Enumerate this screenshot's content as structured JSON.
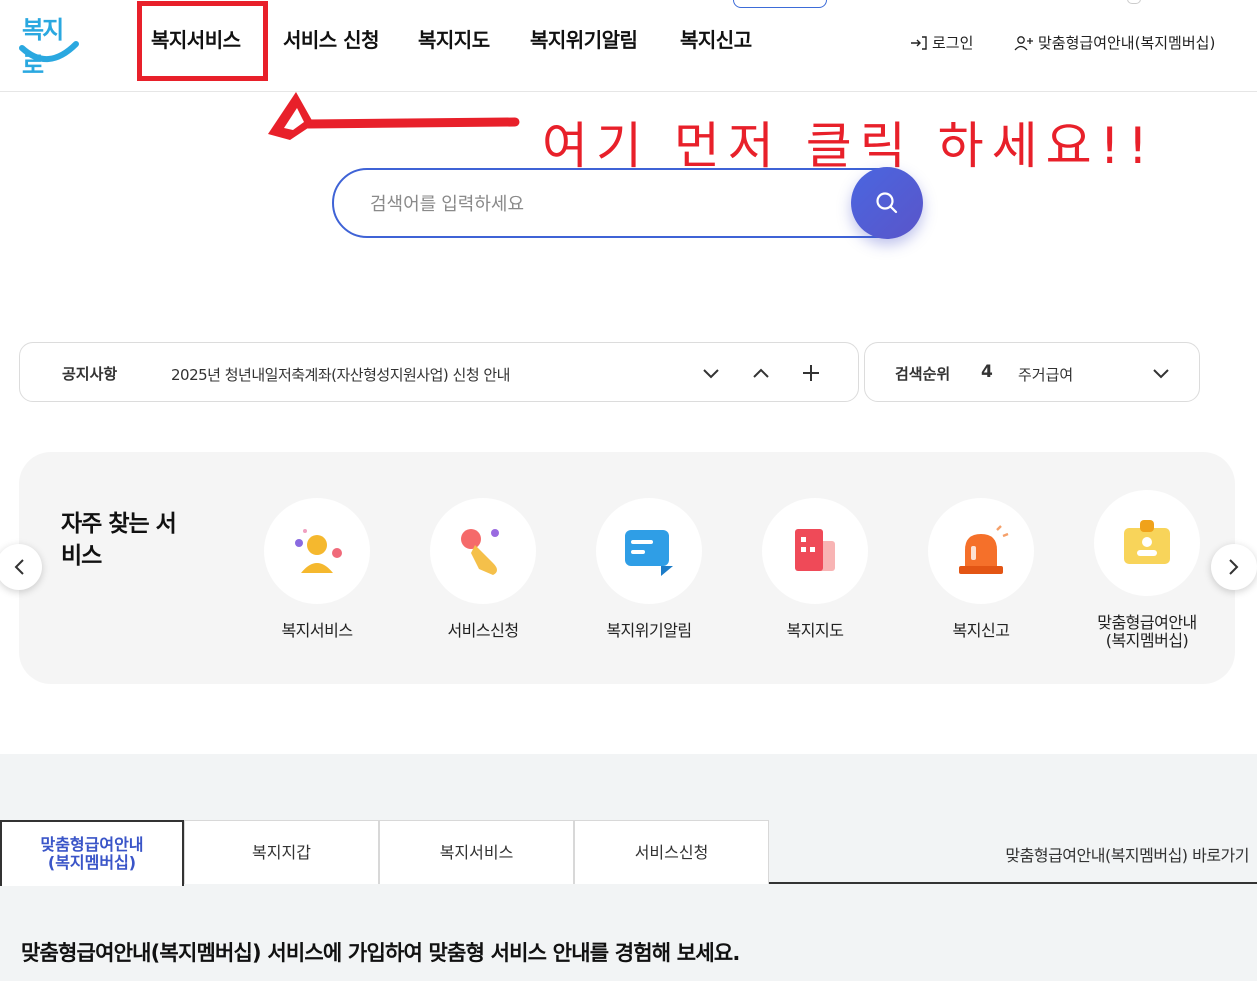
{
  "header": {
    "logo_text": "복지로",
    "nav": [
      "복지서비스",
      "서비스 신청",
      "복지지도",
      "복지위기알림",
      "복지신고"
    ],
    "login_label": "로그인",
    "membership_label": "맞춤형급여안내(복지멤버십)"
  },
  "annotation": {
    "text": "여기 먼저 클릭 하세요!!",
    "color": "#e8202a"
  },
  "search": {
    "placeholder": "검색어를 입력하세요"
  },
  "notice": {
    "label": "공지사항",
    "text": "2025년 청년내일저축계좌(자산형성지원사업) 신청 안내"
  },
  "ranking": {
    "label": "검색순위",
    "rank": "4",
    "term": "주거급여"
  },
  "frequent": {
    "title": "자주 찾는 서비스",
    "items": [
      {
        "label": "복지서비스",
        "icon": "person-icon"
      },
      {
        "label": "서비스신청",
        "icon": "hand-tap-icon"
      },
      {
        "label": "복지위기알림",
        "icon": "message-icon"
      },
      {
        "label": "복지지도",
        "icon": "building-icon"
      },
      {
        "label": "복지신고",
        "icon": "siren-icon"
      },
      {
        "label": "맞춤형급여안내\n(복지멤버십)",
        "icon": "id-badge-icon"
      }
    ]
  },
  "tabs": [
    {
      "label": "맞춤형급여안내\n(복지멤버십)",
      "active": true
    },
    {
      "label": "복지지갑",
      "active": false
    },
    {
      "label": "복지서비스",
      "active": false
    },
    {
      "label": "서비스신청",
      "active": false
    }
  ],
  "shortcut_label": "맞춤형급여안내(복지멤버십) 바로가기",
  "bottom_heading": "맞춤형급여안내(복지멤버십) 서비스에 가입하여 맞춤형 서비스 안내를 경험해 보세요.",
  "colors": {
    "accent": "#3f63d6",
    "annotation": "#e8202a",
    "logo": "#2aa8e0"
  }
}
